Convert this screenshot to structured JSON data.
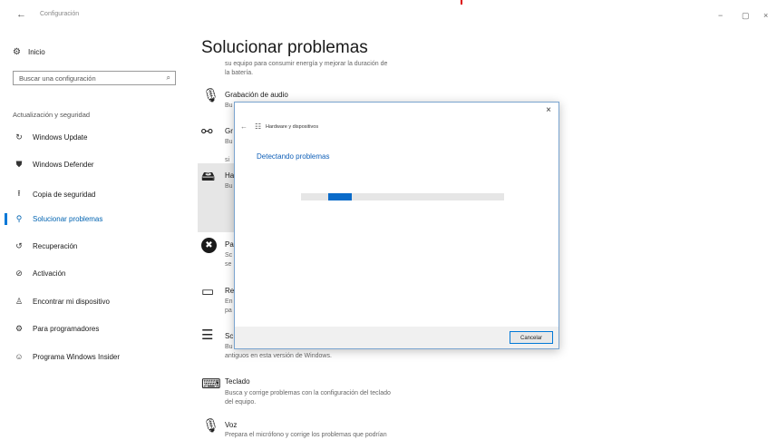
{
  "window": {
    "title": "Configuración",
    "back_icon": "back-arrow-icon",
    "controls": [
      "−",
      "▢",
      "×"
    ]
  },
  "sidebar": {
    "home": {
      "label": "Inicio",
      "icon": "gear-icon",
      "glyph": "⚙"
    },
    "search": {
      "placeholder": "Buscar una configuración",
      "icon": "search-icon",
      "glyph": "⌕"
    },
    "section_title": "Actualización y seguridad",
    "items": [
      {
        "label": "Windows Update",
        "icon": "refresh-icon",
        "glyph": "↻"
      },
      {
        "label": "Windows Defender",
        "icon": "shield-icon",
        "glyph": "⛊"
      },
      {
        "label": "Copia de seguridad",
        "icon": "backup-icon",
        "glyph": "⭱"
      },
      {
        "label": "Solucionar problemas",
        "icon": "wrench-icon",
        "glyph": "⚲",
        "active": true
      },
      {
        "label": "Recuperación",
        "icon": "history-icon",
        "glyph": "↺"
      },
      {
        "label": "Activación",
        "icon": "check-circle-icon",
        "glyph": "⊘"
      },
      {
        "label": "Encontrar mi dispositivo",
        "icon": "person-pin-icon",
        "glyph": "♙"
      },
      {
        "label": "Para programadores",
        "icon": "developer-icon",
        "glyph": "⚙"
      },
      {
        "label": "Programa Windows Insider",
        "icon": "insider-icon",
        "glyph": "☺"
      }
    ]
  },
  "main": {
    "title": "Solucionar problemas",
    "partial_top": [
      "su equipo para consumir energía y mejorar la duración de",
      "la batería."
    ],
    "items": [
      {
        "title": "Grabación de audio",
        "desc": [
          "Bu"
        ],
        "icon": "microphone-icon",
        "glyph": "🎙"
      },
      {
        "title": "Gr",
        "desc": [
          "Bu",
          "",
          "si"
        ],
        "icon": "network-icon",
        "glyph": "⚯"
      },
      {
        "title": "Ha",
        "desc": [
          "Bu"
        ],
        "icon": "hardware-icon",
        "glyph": "🖴"
      },
      {
        "title": "Pa",
        "desc": [
          "Sc",
          "se"
        ],
        "icon": "blocked-icon",
        "glyph": "✖"
      },
      {
        "title": "Re",
        "desc": [
          "En",
          "pa"
        ],
        "icon": "video-icon",
        "glyph": "▭"
      },
      {
        "title": "Sc",
        "desc": [
          "Bu",
          "antiguos en esta versión de Windows."
        ],
        "icon": "list-icon",
        "glyph": "☰"
      },
      {
        "title": "Teclado",
        "desc": [
          "Busca y corrige problemas con la configuración del teclado",
          "del equipo."
        ],
        "icon": "keyboard-icon",
        "glyph": "⌨"
      },
      {
        "title": "Voz",
        "desc": [
          "Prepara el micrófono y corrige los problemas que podrían"
        ],
        "icon": "microphone-icon",
        "glyph": "🎙"
      }
    ]
  },
  "dialog": {
    "title": "Hardware y dispositivos",
    "status": "Detectando problemas",
    "close_glyph": "×",
    "back_glyph": "←",
    "cancel_label": "Cancelar",
    "progress": "indeterminate"
  }
}
